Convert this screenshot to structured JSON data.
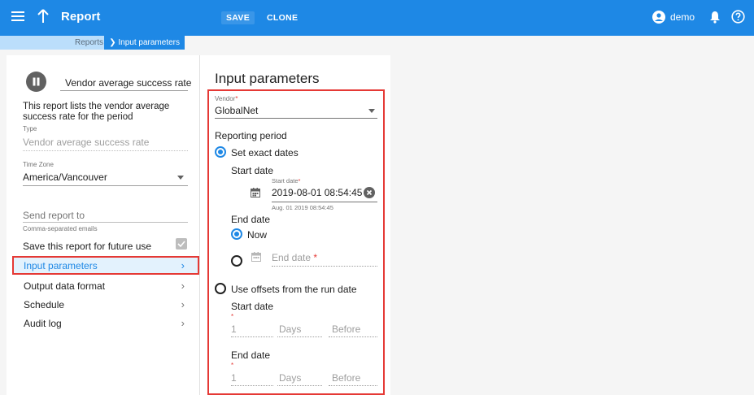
{
  "topbar": {
    "title": "Report",
    "save_label": "SAVE",
    "clone_label": "CLONE",
    "user_label": "demo"
  },
  "breadcrumb": {
    "parent": "Reports",
    "current": "Input parameters"
  },
  "left": {
    "report_name": "Vendor average success rate",
    "description_line1": "This report lists the vendor average",
    "description_line2": "success rate for the period",
    "type_label": "Type",
    "type_value": "Vendor average success rate",
    "timezone_label": "Time Zone",
    "timezone_value": "America/Vancouver",
    "send_to_placeholder": "Send report to",
    "send_to_hint": "Comma-separated emails",
    "save_future_label": "Save this report for future use",
    "save_future_checked": true,
    "nav": [
      {
        "label": "Input parameters",
        "active": true
      },
      {
        "label": "Output data format",
        "active": false
      },
      {
        "label": "Schedule",
        "active": false
      },
      {
        "label": "Audit log",
        "active": false
      }
    ]
  },
  "input_params": {
    "title": "Input parameters",
    "vendor_label": "Vendor",
    "vendor_value": "GlobalNet",
    "reporting_period_label": "Reporting period",
    "set_exact_dates_label": "Set exact dates",
    "start_date_heading": "Start date",
    "start_date_field_label": "Start date",
    "start_date_value": "2019-08-01 08:54:45",
    "start_date_hint": "Aug. 01 2019 08:54:45",
    "end_date_heading": "End date",
    "now_label": "Now",
    "end_date_placeholder": "End date",
    "use_offsets_label": "Use offsets from the run date",
    "offset_start_heading": "Start date",
    "offset_start_amount": "1",
    "offset_start_unit": "Days",
    "offset_start_direction": "Before",
    "offset_end_heading": "End date",
    "offset_end_amount": "1",
    "offset_end_unit": "Days",
    "offset_end_direction": "Before",
    "required_mark": "*"
  },
  "colors": {
    "topbar": "#1e88e5",
    "highlight": "#e53935"
  }
}
